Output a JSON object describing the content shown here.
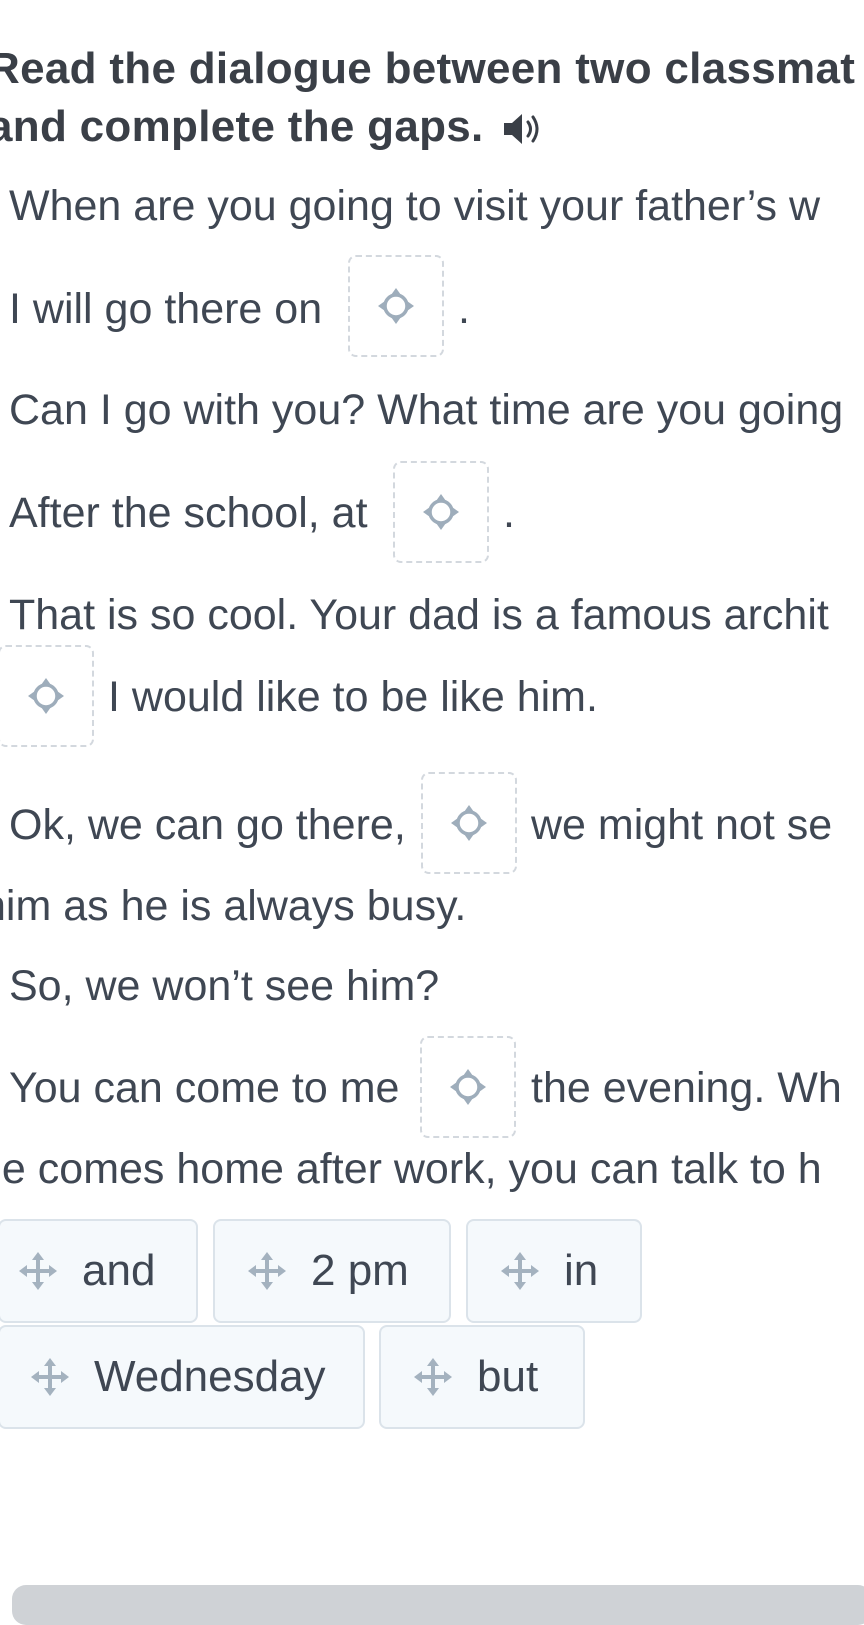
{
  "instruction": {
    "line1": "Read the dialogue between two classmat",
    "line2": "and complete the gaps.",
    "audio_icon": "speaker-icon"
  },
  "dialogue": {
    "l1": "When are you going to visit your father’s w",
    "l2_pre": "I will go there on",
    "l2_post": ".",
    "l3": "Can I go with you? What time are you going",
    "l4_pre": "After the school, at",
    "l4_post": ".",
    "l5": "That is so cool. Your dad is a famous archit",
    "l6_post": "I would like to be like him.",
    "l7_pre": "Ok, we can go there,",
    "l7_post": "we might not se",
    "l8": "him as he is always busy.",
    "l9": "So, we won’t see him?",
    "l10_pre": "You can come to me",
    "l10_post": "the evening. Wh",
    "l11": "he comes home after work, you can talk to h"
  },
  "gap_icon": "drop-target-icon",
  "word_bank": {
    "drag_icon": "move-arrows-icon",
    "options": [
      "and",
      "2 pm",
      "in",
      "Wednesday",
      "but"
    ]
  },
  "colors": {
    "text": "#3f4753",
    "gap_border": "#d3d8de",
    "chip_bg": "#f5f9fc",
    "chip_border": "#dbe3ea",
    "icon": "#9eadbb"
  }
}
